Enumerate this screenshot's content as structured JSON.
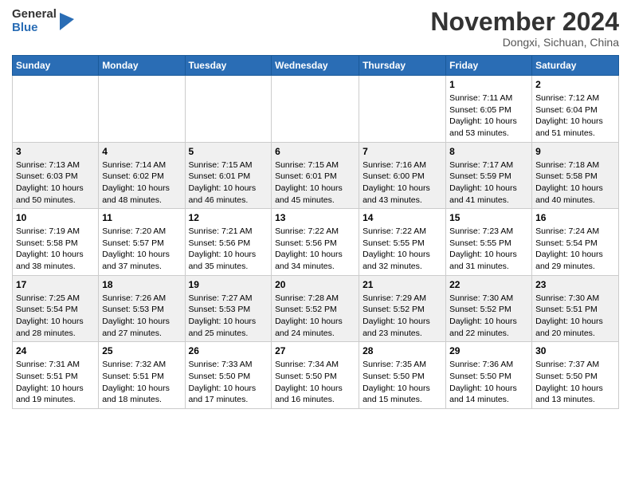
{
  "header": {
    "logo_general": "General",
    "logo_blue": "Blue",
    "month_title": "November 2024",
    "location": "Dongxi, Sichuan, China"
  },
  "weekdays": [
    "Sunday",
    "Monday",
    "Tuesday",
    "Wednesday",
    "Thursday",
    "Friday",
    "Saturday"
  ],
  "weeks": [
    [
      {
        "day": "",
        "info": ""
      },
      {
        "day": "",
        "info": ""
      },
      {
        "day": "",
        "info": ""
      },
      {
        "day": "",
        "info": ""
      },
      {
        "day": "",
        "info": ""
      },
      {
        "day": "1",
        "info": "Sunrise: 7:11 AM\nSunset: 6:05 PM\nDaylight: 10 hours and 53 minutes."
      },
      {
        "day": "2",
        "info": "Sunrise: 7:12 AM\nSunset: 6:04 PM\nDaylight: 10 hours and 51 minutes."
      }
    ],
    [
      {
        "day": "3",
        "info": "Sunrise: 7:13 AM\nSunset: 6:03 PM\nDaylight: 10 hours and 50 minutes."
      },
      {
        "day": "4",
        "info": "Sunrise: 7:14 AM\nSunset: 6:02 PM\nDaylight: 10 hours and 48 minutes."
      },
      {
        "day": "5",
        "info": "Sunrise: 7:15 AM\nSunset: 6:01 PM\nDaylight: 10 hours and 46 minutes."
      },
      {
        "day": "6",
        "info": "Sunrise: 7:15 AM\nSunset: 6:01 PM\nDaylight: 10 hours and 45 minutes."
      },
      {
        "day": "7",
        "info": "Sunrise: 7:16 AM\nSunset: 6:00 PM\nDaylight: 10 hours and 43 minutes."
      },
      {
        "day": "8",
        "info": "Sunrise: 7:17 AM\nSunset: 5:59 PM\nDaylight: 10 hours and 41 minutes."
      },
      {
        "day": "9",
        "info": "Sunrise: 7:18 AM\nSunset: 5:58 PM\nDaylight: 10 hours and 40 minutes."
      }
    ],
    [
      {
        "day": "10",
        "info": "Sunrise: 7:19 AM\nSunset: 5:58 PM\nDaylight: 10 hours and 38 minutes."
      },
      {
        "day": "11",
        "info": "Sunrise: 7:20 AM\nSunset: 5:57 PM\nDaylight: 10 hours and 37 minutes."
      },
      {
        "day": "12",
        "info": "Sunrise: 7:21 AM\nSunset: 5:56 PM\nDaylight: 10 hours and 35 minutes."
      },
      {
        "day": "13",
        "info": "Sunrise: 7:22 AM\nSunset: 5:56 PM\nDaylight: 10 hours and 34 minutes."
      },
      {
        "day": "14",
        "info": "Sunrise: 7:22 AM\nSunset: 5:55 PM\nDaylight: 10 hours and 32 minutes."
      },
      {
        "day": "15",
        "info": "Sunrise: 7:23 AM\nSunset: 5:55 PM\nDaylight: 10 hours and 31 minutes."
      },
      {
        "day": "16",
        "info": "Sunrise: 7:24 AM\nSunset: 5:54 PM\nDaylight: 10 hours and 29 minutes."
      }
    ],
    [
      {
        "day": "17",
        "info": "Sunrise: 7:25 AM\nSunset: 5:54 PM\nDaylight: 10 hours and 28 minutes."
      },
      {
        "day": "18",
        "info": "Sunrise: 7:26 AM\nSunset: 5:53 PM\nDaylight: 10 hours and 27 minutes."
      },
      {
        "day": "19",
        "info": "Sunrise: 7:27 AM\nSunset: 5:53 PM\nDaylight: 10 hours and 25 minutes."
      },
      {
        "day": "20",
        "info": "Sunrise: 7:28 AM\nSunset: 5:52 PM\nDaylight: 10 hours and 24 minutes."
      },
      {
        "day": "21",
        "info": "Sunrise: 7:29 AM\nSunset: 5:52 PM\nDaylight: 10 hours and 23 minutes."
      },
      {
        "day": "22",
        "info": "Sunrise: 7:30 AM\nSunset: 5:52 PM\nDaylight: 10 hours and 22 minutes."
      },
      {
        "day": "23",
        "info": "Sunrise: 7:30 AM\nSunset: 5:51 PM\nDaylight: 10 hours and 20 minutes."
      }
    ],
    [
      {
        "day": "24",
        "info": "Sunrise: 7:31 AM\nSunset: 5:51 PM\nDaylight: 10 hours and 19 minutes."
      },
      {
        "day": "25",
        "info": "Sunrise: 7:32 AM\nSunset: 5:51 PM\nDaylight: 10 hours and 18 minutes."
      },
      {
        "day": "26",
        "info": "Sunrise: 7:33 AM\nSunset: 5:50 PM\nDaylight: 10 hours and 17 minutes."
      },
      {
        "day": "27",
        "info": "Sunrise: 7:34 AM\nSunset: 5:50 PM\nDaylight: 10 hours and 16 minutes."
      },
      {
        "day": "28",
        "info": "Sunrise: 7:35 AM\nSunset: 5:50 PM\nDaylight: 10 hours and 15 minutes."
      },
      {
        "day": "29",
        "info": "Sunrise: 7:36 AM\nSunset: 5:50 PM\nDaylight: 10 hours and 14 minutes."
      },
      {
        "day": "30",
        "info": "Sunrise: 7:37 AM\nSunset: 5:50 PM\nDaylight: 10 hours and 13 minutes."
      }
    ]
  ]
}
